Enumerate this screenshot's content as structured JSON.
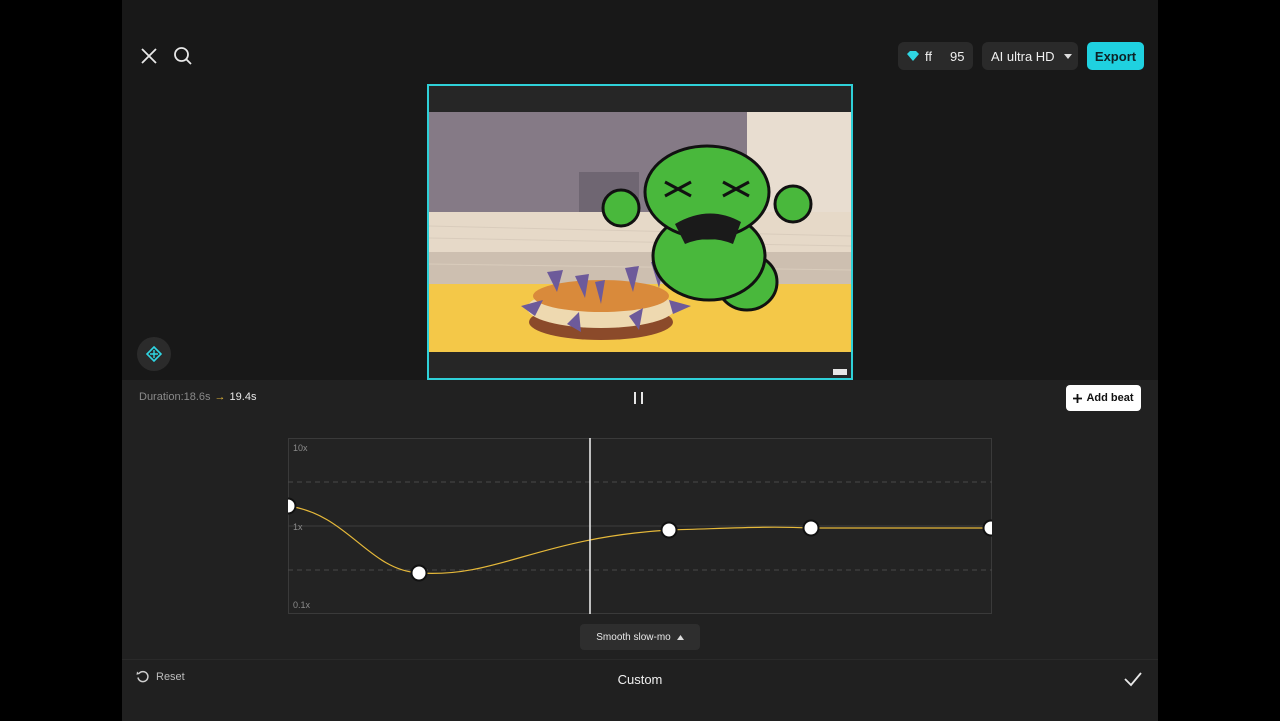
{
  "toolbar": {
    "credits_label": "ff",
    "credits_value": "95",
    "quality_label": "AI ultra HD",
    "export_label": "Export"
  },
  "speed": {
    "duration_label": "Duration:18.6s",
    "new_duration": "19.4s",
    "add_beat_label": "Add beat",
    "graph_labels": [
      "10x",
      "1x",
      "0.1x"
    ],
    "preset_label": "Smooth slow-mo"
  },
  "bottom": {
    "reset_label": "Reset",
    "mode_label": "Custom"
  },
  "colors": {
    "accent": "#1fd1e0",
    "curve": "#e6b93a",
    "preview_border": "#2fd0d8"
  },
  "icons": [
    "close-icon",
    "search-icon",
    "diamond-icon",
    "caret-down-icon",
    "keyframe-icon",
    "pause-icon",
    "plus-icon",
    "reset-icon",
    "caret-up-icon",
    "check-icon"
  ]
}
